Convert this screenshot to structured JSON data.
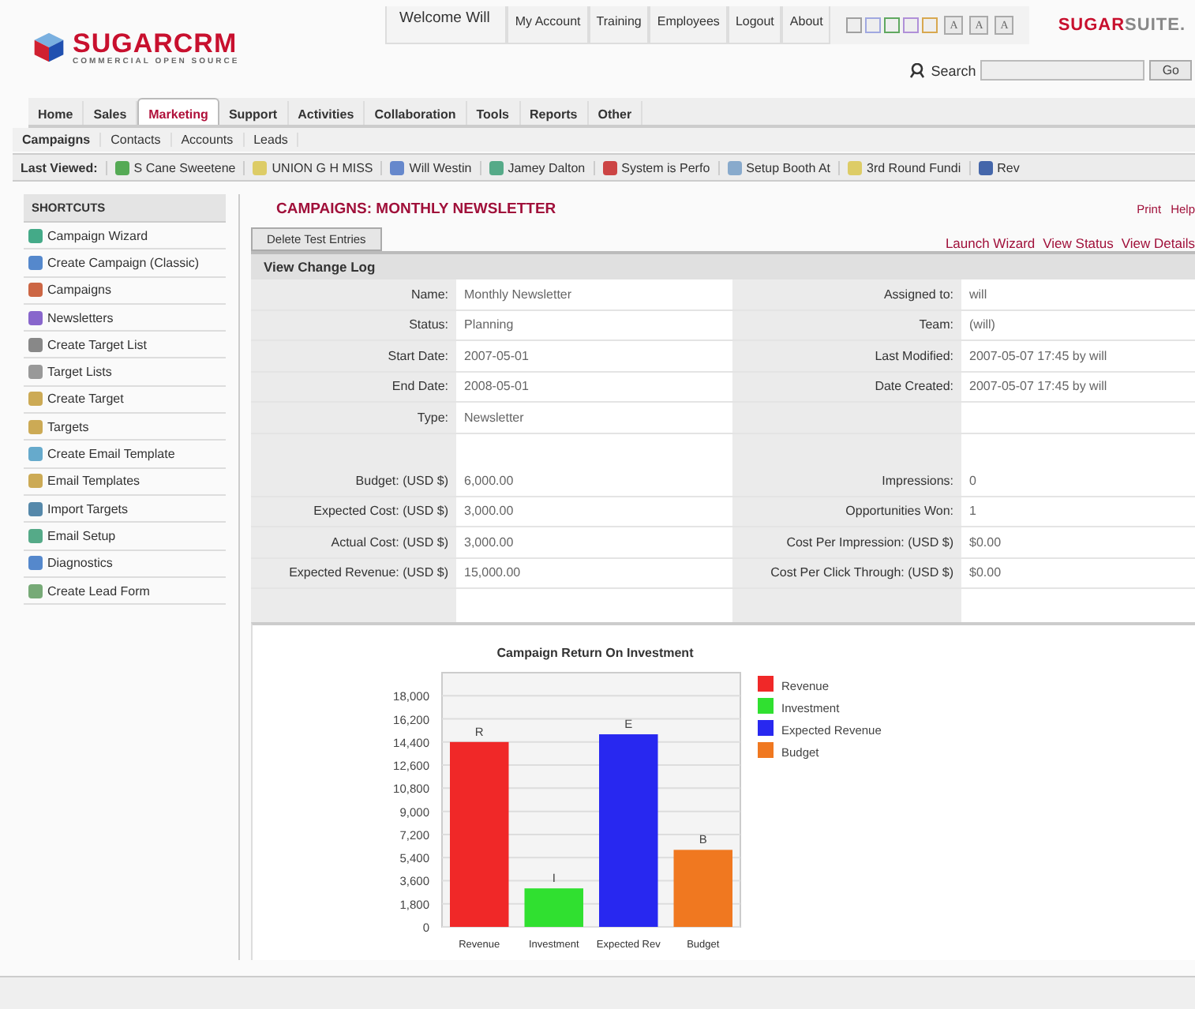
{
  "header": {
    "logo": {
      "name": "SUGARCRM",
      "tagline": "COMMERCIAL OPEN SOURCE"
    },
    "top_links": [
      {
        "label": "Welcome Will",
        "kind": "welcome"
      },
      {
        "label": "My Account",
        "kind": "link"
      },
      {
        "label": "Training",
        "kind": "link"
      },
      {
        "label": "Employees",
        "kind": "link"
      },
      {
        "label": "Logout",
        "kind": "link"
      },
      {
        "label": "About",
        "kind": "link"
      }
    ],
    "themes": [
      {
        "color": "#a0a0a0"
      },
      {
        "color": "#a0a8e0"
      },
      {
        "color": "#60a860"
      },
      {
        "color": "#b090d8"
      },
      {
        "color": "#d8a850"
      }
    ],
    "font_sizes": [
      "A",
      "A",
      "A"
    ],
    "brand": {
      "first": "SUGAR",
      "second": "SUITE."
    },
    "search": {
      "label": "Search",
      "button": "Go"
    }
  },
  "tabs": [
    {
      "label": "Home",
      "selected": false
    },
    {
      "label": "Sales",
      "selected": false
    },
    {
      "label": "Marketing",
      "selected": true
    },
    {
      "label": "Support",
      "selected": false
    },
    {
      "label": "Activities",
      "selected": false
    },
    {
      "label": "Collaboration",
      "selected": false
    },
    {
      "label": "Tools",
      "selected": false
    },
    {
      "label": "Reports",
      "selected": false
    },
    {
      "label": "Other",
      "selected": false
    }
  ],
  "subtabs": [
    {
      "label": "Campaigns",
      "selected": true
    },
    {
      "label": "Contacts",
      "selected": false
    },
    {
      "label": "Accounts",
      "selected": false
    },
    {
      "label": "Leads",
      "selected": false
    }
  ],
  "last_viewed": {
    "label": "Last Viewed:",
    "items": [
      "S Cane Sweetene",
      "UNION G H MISS",
      "Will Westin",
      "Jamey Dalton",
      "System is Perfo",
      "Setup Booth At",
      "3rd Round Fundi",
      "Rev"
    ]
  },
  "sidebar": {
    "title": "SHORTCUTS",
    "items": [
      "Campaign Wizard",
      "Create Campaign (Classic)",
      "Campaigns",
      "Newsletters",
      "Create Target List",
      "Target Lists",
      "Create Target",
      "Targets",
      "Create Email Template",
      "Email Templates",
      "Import Targets",
      "Email Setup",
      "Diagnostics",
      "Create Lead Form"
    ]
  },
  "main": {
    "title": "CAMPAIGNS: MONTHLY NEWSLETTER",
    "tools": [
      "Print",
      "Help"
    ],
    "button": "Delete Test Entries",
    "actions": [
      "Launch Wizard",
      "View Status",
      "View Details"
    ],
    "section": "View Change Log",
    "rows": [
      {
        "left": {
          "label": "Name:",
          "value": "Monthly Newsletter"
        },
        "right": {
          "label": "Assigned to:",
          "value": "will"
        }
      },
      {
        "left": {
          "label": "Status:",
          "value": "Planning"
        },
        "right": {
          "label": "Team:",
          "value": "(will)"
        }
      },
      {
        "left": {
          "label": "Start Date:",
          "value": "2007-05-01"
        },
        "right": {
          "label": "Last Modified:",
          "value": "2007-05-07 17:45 by will"
        }
      },
      {
        "left": {
          "label": "End Date:",
          "value": "2008-05-01"
        },
        "right": {
          "label": "Date Created:",
          "value": "2007-05-07 17:45 by will"
        }
      },
      {
        "left": {
          "label": "Type:",
          "value": "Newsletter"
        }
      },
      {
        "kind": "spacer"
      },
      {
        "left": {
          "label": "Budget: (USD $)",
          "value": "6,000.00"
        },
        "right": {
          "label": "Impressions:",
          "value": "0"
        }
      },
      {
        "left": {
          "label": "Expected Cost: (USD $)",
          "value": "3,000.00"
        },
        "right": {
          "label": "Opportunities Won:",
          "value": "1"
        }
      },
      {
        "left": {
          "label": "Actual Cost: (USD $)",
          "value": "3,000.00"
        },
        "right": {
          "label": "Cost Per Impression: (USD $)",
          "value": "$0.00"
        }
      },
      {
        "left": {
          "label": "Expected Revenue: (USD $)",
          "value": "15,000.00"
        },
        "right": {
          "label": "Cost Per Click Through: (USD $)",
          "value": "$0.00"
        }
      },
      {
        "kind": "spacer"
      }
    ],
    "chart_data": {
      "type": "bar",
      "title": "Campaign Return On Investment",
      "categories": [
        "Revenue",
        "Investment",
        "Expected Rev",
        "Budget"
      ],
      "series": [
        {
          "name": "Revenue",
          "color": "#f02828",
          "values": [
            14400,
            null,
            null,
            null
          ]
        },
        {
          "name": "Investment",
          "color": "#30e030",
          "values": [
            null,
            3000,
            null,
            null
          ]
        },
        {
          "name": "Expected Revenue",
          "color": "#2828f0",
          "values": [
            null,
            null,
            15000,
            null
          ]
        },
        {
          "name": "Budget",
          "color": "#f07820",
          "values": [
            null,
            null,
            null,
            6000
          ]
        }
      ],
      "stacked": true,
      "grid": true,
      "legend": true,
      "ylim": [
        0,
        19800
      ],
      "yticks": [
        0,
        {
          "value": 1800,
          "label": "1,800"
        },
        {
          "value": 3600,
          "label": "3,600"
        },
        {
          "value": 5400,
          "label": "5,400"
        },
        {
          "value": 7200,
          "label": "7,200"
        },
        {
          "value": 9000,
          "label": "9,000"
        },
        {
          "value": 10800,
          "label": "10,800"
        },
        {
          "value": 12600,
          "label": "12,600"
        },
        {
          "value": 14400,
          "label": "14,400"
        },
        {
          "value": 16200,
          "label": "16,200"
        },
        {
          "value": 18000,
          "label": "18,000"
        }
      ],
      "value_labels": [
        "R",
        "I",
        "E",
        "B"
      ]
    }
  }
}
